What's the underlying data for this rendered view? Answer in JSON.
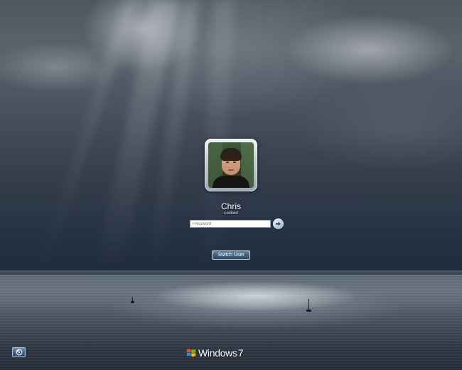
{
  "screen": {
    "title": "Windows 7 lock screen"
  },
  "user": {
    "name": "Chris",
    "status": "Locked",
    "avatar_icon": "user-photo"
  },
  "login": {
    "password_placeholder": "Password",
    "password_value": "",
    "submit_icon": "arrow-right-icon",
    "switch_user_label": "Switch User"
  },
  "footer": {
    "ease_of_access_icon": "ease-of-access-icon",
    "brand_logo_icon": "windows-flag-icon",
    "brand_name": "Windows",
    "brand_version": "7"
  },
  "colors": {
    "button_blue": "#40617f",
    "text": "#ffffff"
  }
}
